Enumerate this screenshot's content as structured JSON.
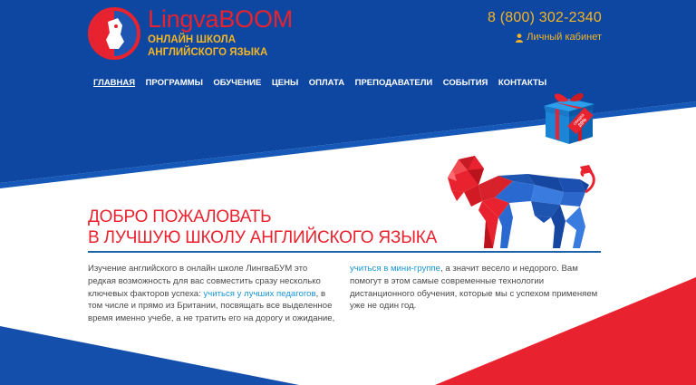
{
  "brand": {
    "name": "LingvaBOOM",
    "subtitle_line1": "ОНЛАЙН ШКОЛА",
    "subtitle_line2": "АНГЛИЙСКОГО ЯЗЫКА"
  },
  "contacts": {
    "phone": "8 (800) 302-2340",
    "cabinet_label": "Личный кабинет"
  },
  "nav": {
    "items": [
      {
        "label": "ГЛАВНАЯ",
        "active": true
      },
      {
        "label": "ПРОГРАММЫ"
      },
      {
        "label": "ОБУЧЕНИЕ"
      },
      {
        "label": "ЦЕНЫ"
      },
      {
        "label": "ОПЛАТА"
      },
      {
        "label": "ПРЕПОДАВАТЕЛИ"
      },
      {
        "label": "СОБЫТИЯ"
      },
      {
        "label": "КОНТАКТЫ"
      }
    ]
  },
  "gift": {
    "badge_line1": "скидка",
    "badge_line2": "20%"
  },
  "hero": {
    "title_line1": "ДОБРО ПОЖАЛОВАТЬ",
    "title_line2": "В ЛУЧШУЮ ШКОЛУ АНГЛИЙСКОГО ЯЗЫКА"
  },
  "intro": {
    "col1_text_before": "Изучение английского в онлайн школе ЛингваБУМ это редкая возможность для вас совместить сразу несколько ключевых факторов успеха: ",
    "col1_link": "учиться у лучших педагогов",
    "col1_text_after": ", в том числе и прямо из Британии, посвящать все выделенное время именно учебе, а не тратить его на дорогу и ожидание,",
    "col2_link": "учиться в мини-группе",
    "col2_text_after": ", а значит весело и недорого. Вам помогут в этом самые современные технологии дистанционного обучения, которые мы с успехом применяем уже не один год."
  },
  "colors": {
    "blue": "#0d47a1",
    "red": "#e8222e",
    "yellow": "#f5b523",
    "link": "#1b96d4"
  }
}
